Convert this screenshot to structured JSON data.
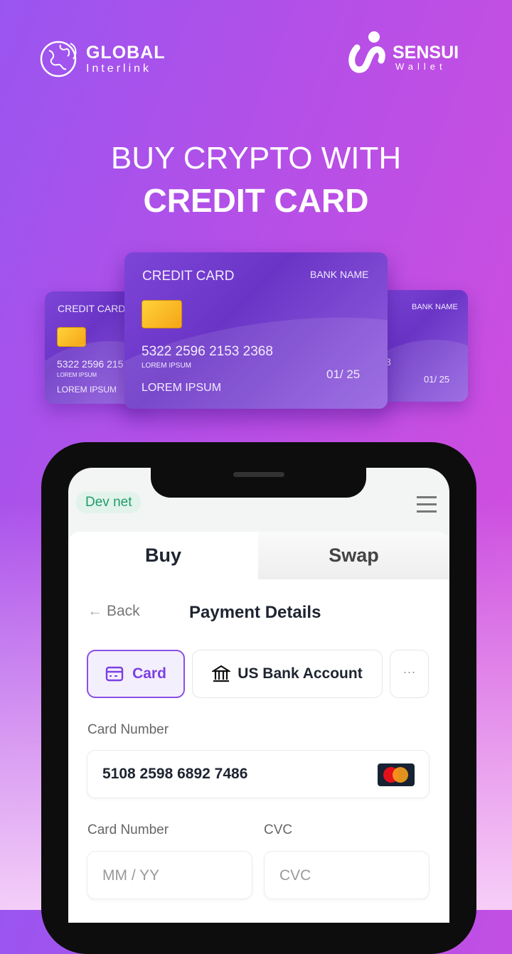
{
  "brand_left": {
    "name": "GLOBAL",
    "sub": "Interlink"
  },
  "brand_right": {
    "name": "SENSUI",
    "sub": "Wallet"
  },
  "headline": {
    "line1": "BUY CRYPTO WITH",
    "line2": "CREDIT CARD"
  },
  "cards": {
    "front": {
      "type": "CREDIT CARD",
      "bank": "BANK NAME",
      "number": "5322 2596 2153 2368",
      "small": "LOREM IPSUM",
      "holder": "LOREM IPSUM",
      "expiry": "01/ 25"
    },
    "left": {
      "type": "CREDIT CARD",
      "number": "5322 2596 215",
      "small": "LOREM IPSUM",
      "holder": "LOREM IPSUM"
    },
    "right": {
      "bank": "BANK NAME",
      "number_fragment": "8",
      "expiry": "01/ 25"
    }
  },
  "app": {
    "network_badge": "Dev net",
    "tabs": [
      {
        "label": "Buy",
        "active": true
      },
      {
        "label": "Swap",
        "active": false
      }
    ],
    "back_label": "Back",
    "title": "Payment Details",
    "methods": [
      {
        "label": "Card",
        "icon": "credit-card-icon",
        "active": true
      },
      {
        "label": "US Bank Account",
        "icon": "bank-icon",
        "active": false
      },
      {
        "label": "···",
        "icon": "more-icon"
      }
    ],
    "card_number_label": "Card Number",
    "card_number_value": "5108 2598 6892 7486",
    "expiry_label": "Card Number",
    "expiry_placeholder": "MM / YY",
    "cvc_label": "CVC",
    "cvc_placeholder": "CVC",
    "accent": "#7b3fe4",
    "badge_color": "#1f9d6b"
  }
}
